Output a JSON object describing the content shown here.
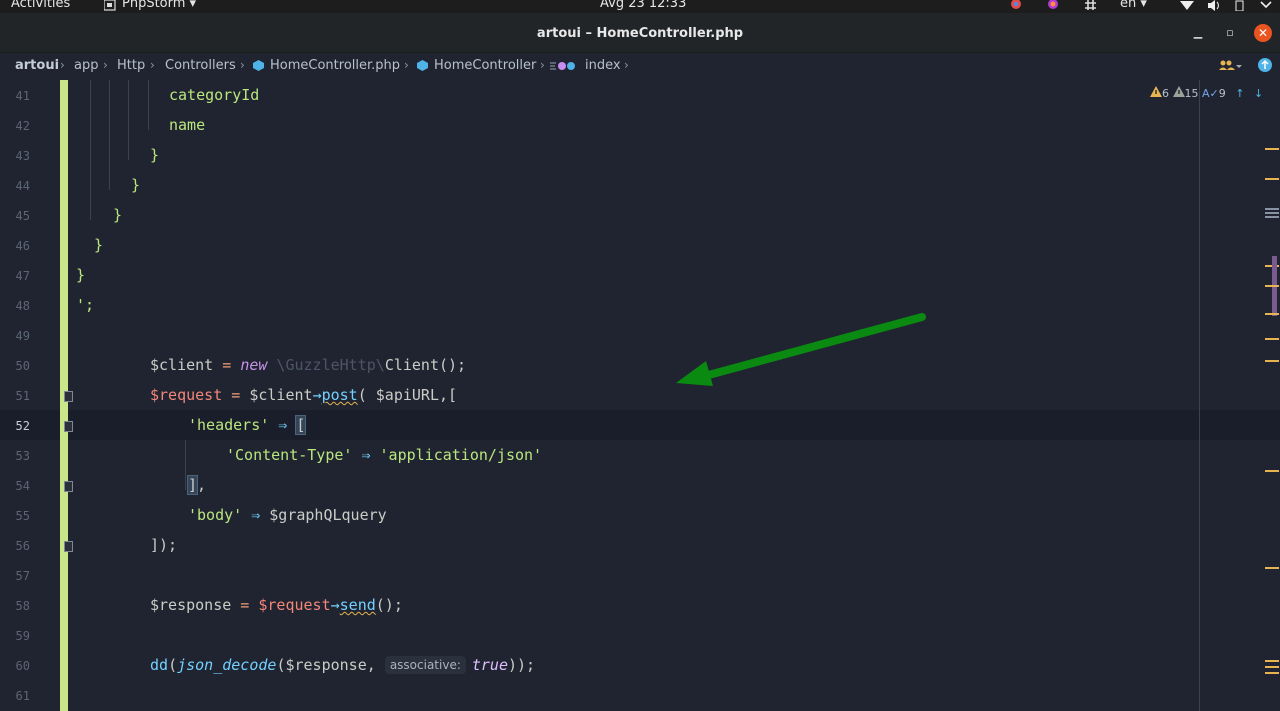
{
  "topbar": {
    "activities": "Activities",
    "app_name": "PhpStorm",
    "clock": "Avg 23  12:33",
    "lang": "en"
  },
  "window": {
    "title": "artoui – HomeController.php"
  },
  "breadcrumb": {
    "items": [
      "artoui",
      "app",
      "Http",
      "Controllers",
      "HomeController.php",
      "HomeController",
      "index"
    ]
  },
  "inspections": {
    "warnings": "6",
    "weak_warnings": "15",
    "typos": "9"
  },
  "editor": {
    "line_numbers": [
      "41",
      "42",
      "43",
      "44",
      "45",
      "46",
      "47",
      "48",
      "49",
      "50",
      "51",
      "52",
      "53",
      "54",
      "55",
      "56",
      "57",
      "58",
      "59",
      "60",
      "61"
    ],
    "current_line": "52",
    "code": {
      "l41": "categoryId",
      "l42": "name",
      "l43": "}",
      "l44": "}",
      "l45": "}",
      "l46": "}",
      "l47": "}",
      "l48": "';",
      "l50_var": "$client",
      "l50_eq": " = ",
      "l50_new": "new",
      "l50_ns": " \\GuzzleHttp\\",
      "l50_class": "Client();",
      "l51_var": "$request",
      "l51_eq": " = ",
      "l51_obj": "$client",
      "l51_arrow": "→",
      "l51_fn": "post",
      "l51_args": "( $apiURL,[",
      "l52_key": "'headers'",
      "l52_arrow": " ⇒ ",
      "l52_bracket": "[",
      "l53_key": "'Content-Type'",
      "l53_arrow": " ⇒ ",
      "l53_val": "'application/json'",
      "l54_bracket": "]",
      "l54_comma": ",",
      "l55_key": "'body'",
      "l55_arrow": " ⇒ ",
      "l55_val": "$graphQLquery",
      "l56_close": "]);",
      "l58_var": "$response",
      "l58_eq": " = ",
      "l58_obj": "$request",
      "l58_arrow": "→",
      "l58_fn": "send",
      "l58_end": "();",
      "l60_fn": "dd",
      "l60_open": "(",
      "l60_inner": "json_decode",
      "l60_arg": "($response, ",
      "l60_hint": "associative:",
      "l60_bool": "true",
      "l60_end": "));"
    }
  },
  "colors": {
    "annotation_arrow": "#0b8a12",
    "gutter_change": "#c9e68a",
    "string": "#bae67e",
    "keyword": "#c792ea",
    "variable_accent": "#f28779"
  }
}
